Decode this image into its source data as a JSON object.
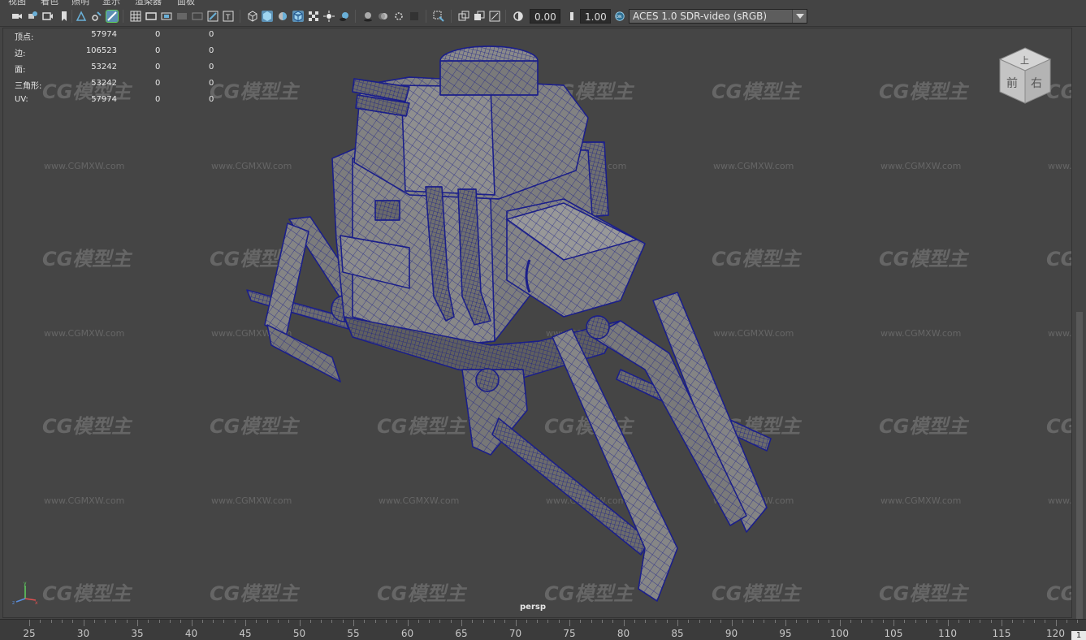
{
  "menu": {
    "items": [
      "视图",
      "着色",
      "照明",
      "显示",
      "渲染器",
      "面板"
    ]
  },
  "toolbar": {
    "exposure_value": "0.00",
    "gamma_value": "1.00",
    "colorspace_badge": "ON",
    "color_management": "ACES 1.0 SDR-video (sRGB)"
  },
  "hud": {
    "rows": [
      {
        "label": "顶点:",
        "value": "57974",
        "sel": "0",
        "uv": "0"
      },
      {
        "label": "边:",
        "value": "106523",
        "sel": "0",
        "uv": "0"
      },
      {
        "label": "面:",
        "value": "53242",
        "sel": "0",
        "uv": "0"
      },
      {
        "label": "三角形:",
        "value": "53242",
        "sel": "0",
        "uv": "0"
      },
      {
        "label": "UV:",
        "value": "57974",
        "sel": "0",
        "uv": "0"
      }
    ]
  },
  "viewcube": {
    "top": "上",
    "front": "前",
    "right": "右"
  },
  "camera_label": "persp",
  "watermark": {
    "logo": "CG模型主",
    "url": "www.CGMXW.com"
  },
  "timeline": {
    "ticks": [
      "25",
      "30",
      "35",
      "40",
      "45",
      "50",
      "55",
      "60",
      "65",
      "70",
      "75",
      "80",
      "85",
      "90",
      "95",
      "100",
      "105",
      "110",
      "115",
      "120"
    ],
    "current_frame": "1"
  },
  "colors": {
    "viewport_bg": "#454545",
    "wire": "#1b1f8a",
    "mesh": "#7b7b7b",
    "ui_accent": "#5b8fb3"
  }
}
